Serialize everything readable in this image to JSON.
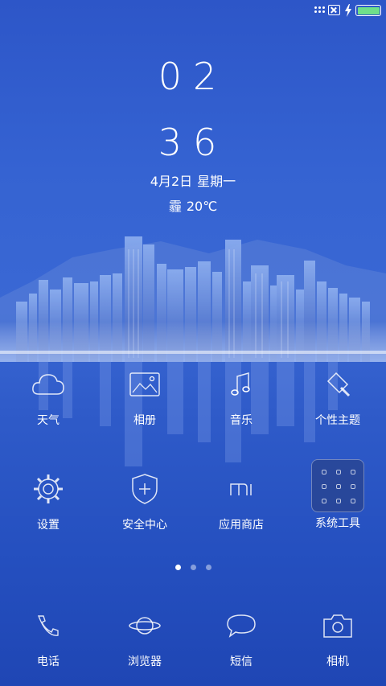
{
  "status_bar": {
    "sim_icon": "sim-x-icon",
    "charging_icon": "bolt-icon",
    "battery_icon": "battery-icon",
    "battery_color": "#6fe08a"
  },
  "clock": {
    "hour": "02",
    "minute": "36"
  },
  "date": {
    "day": "4月2日",
    "weekday": "星期一"
  },
  "weather": {
    "condition": "霾",
    "temperature": "20℃"
  },
  "apps_row1": [
    {
      "label": "天气",
      "icon": "cloud-icon"
    },
    {
      "label": "相册",
      "icon": "photo-icon"
    },
    {
      "label": "音乐",
      "icon": "music-note-icon"
    },
    {
      "label": "个性主题",
      "icon": "brush-icon"
    }
  ],
  "apps_row2": [
    {
      "label": "设置",
      "icon": "gear-icon"
    },
    {
      "label": "安全中心",
      "icon": "shield-plus-icon"
    },
    {
      "label": "应用商店",
      "icon": "mi-store-icon"
    },
    {
      "label": "系统工具",
      "icon": "folder-icon"
    }
  ],
  "page_indicator": {
    "count": 3,
    "active": 1
  },
  "dock": [
    {
      "label": "电话",
      "icon": "phone-icon"
    },
    {
      "label": "浏览器",
      "icon": "planet-icon"
    },
    {
      "label": "短信",
      "icon": "message-icon"
    },
    {
      "label": "相机",
      "icon": "camera-icon"
    }
  ],
  "colors": {
    "background_top": "#2d56c8",
    "background_bottom": "#1f46b4",
    "text": "#ffffff"
  }
}
